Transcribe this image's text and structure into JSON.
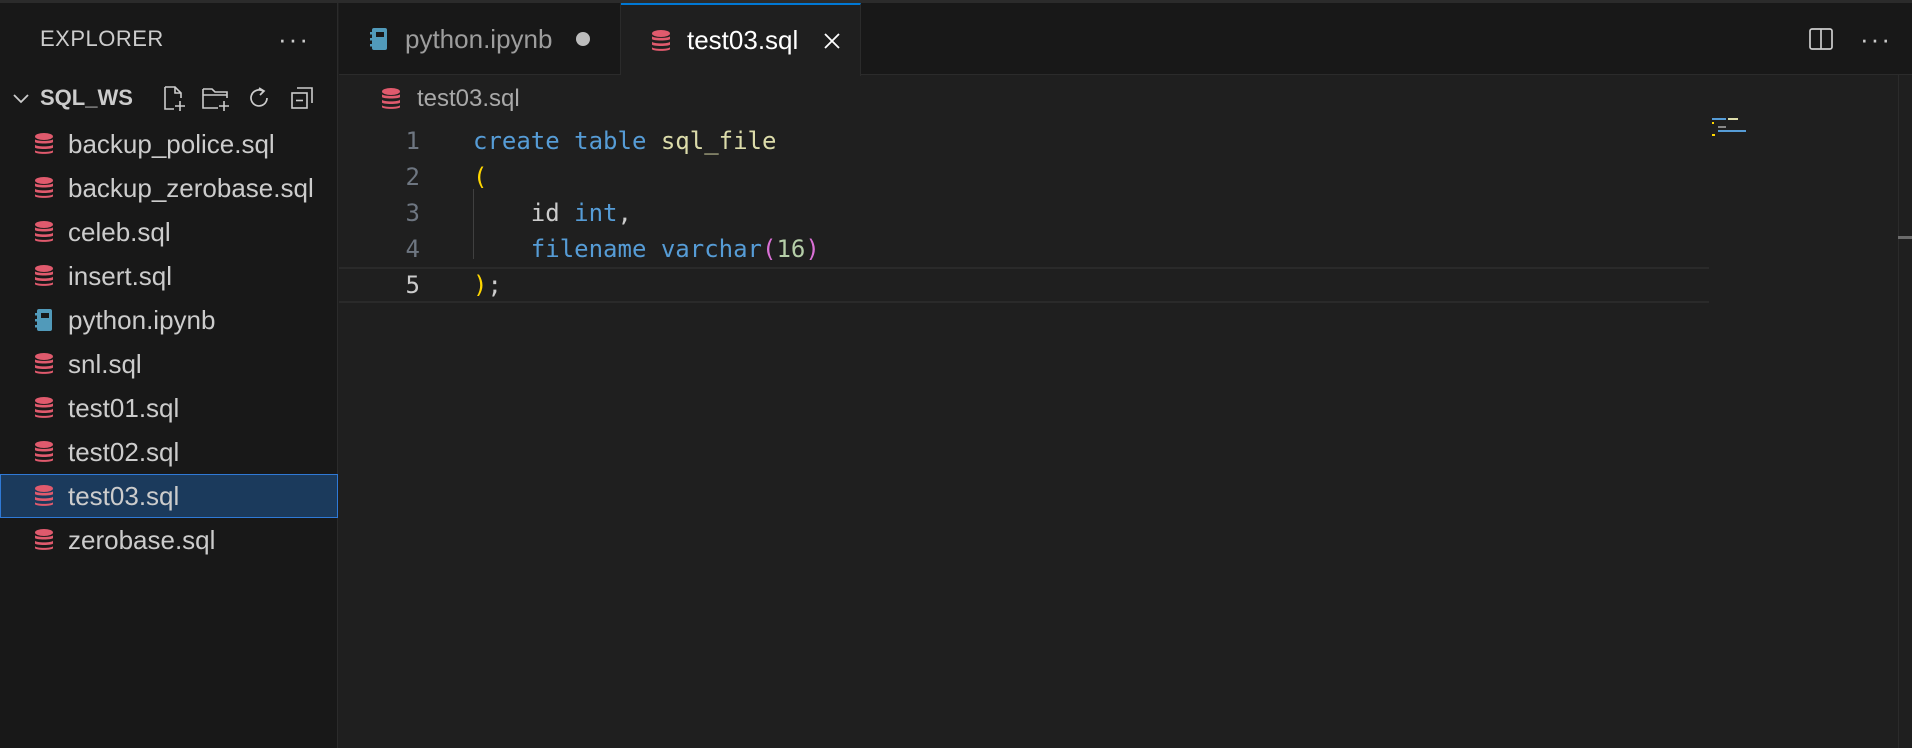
{
  "sidebar": {
    "title": "EXPLORER",
    "more": "···",
    "workspace": "SQL_WS",
    "files": [
      {
        "name": "backup_police.sql",
        "icon": "database-icon"
      },
      {
        "name": "backup_zerobase.sql",
        "icon": "database-icon"
      },
      {
        "name": "celeb.sql",
        "icon": "database-icon"
      },
      {
        "name": "insert.sql",
        "icon": "database-icon"
      },
      {
        "name": "python.ipynb",
        "icon": "notebook-icon"
      },
      {
        "name": "snl.sql",
        "icon": "database-icon"
      },
      {
        "name": "test01.sql",
        "icon": "database-icon"
      },
      {
        "name": "test02.sql",
        "icon": "database-icon"
      },
      {
        "name": "test03.sql",
        "icon": "database-icon",
        "selected": true
      },
      {
        "name": "zerobase.sql",
        "icon": "database-icon"
      }
    ]
  },
  "tabs": [
    {
      "label": "python.ipynb",
      "dirty": true,
      "active": false
    },
    {
      "label": "test03.sql",
      "dirty": false,
      "active": true
    }
  ],
  "tab_actions": {
    "more": "···"
  },
  "breadcrumb": {
    "file": "test03.sql"
  },
  "editor": {
    "line_numbers": [
      "1",
      "2",
      "3",
      "4",
      "5"
    ],
    "active_line": 5,
    "lines": {
      "l1": {
        "kw1": "create",
        "kw2": "table",
        "name": "sql_file"
      },
      "l2": {
        "paren": "("
      },
      "l3": {
        "col": "id",
        "type": "int",
        "punct": ","
      },
      "l4": {
        "col": "filename",
        "type": "varchar",
        "open": "(",
        "num": "16",
        "close": ")"
      },
      "l5": {
        "paren": ")",
        "semi": ";"
      }
    }
  },
  "colors": {
    "accent": "#0078d4",
    "sql_icon": "#e05a6d",
    "notebook_icon": "#519aba",
    "keyword": "#569cd6",
    "function_name": "#dcdcaa"
  }
}
